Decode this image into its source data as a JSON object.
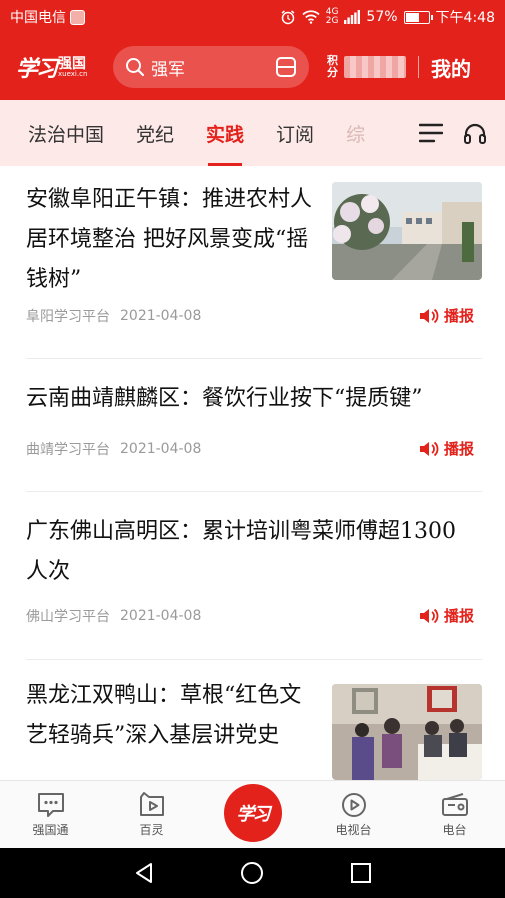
{
  "status_bar": {
    "carrier": "中国电信",
    "network": "4G",
    "network_sub": "2G",
    "battery_percent": "57%",
    "battery_level": 0.57,
    "time": "下午4:48"
  },
  "header": {
    "logo_cn": "学习",
    "logo_sub": "强国",
    "logo_en": "xuexi.cn",
    "search_text": "强军",
    "points_label_top": "积",
    "points_label_bottom": "分",
    "mine_label": "我的"
  },
  "tabs": [
    {
      "label": "法治中国",
      "active": false
    },
    {
      "label": "党纪",
      "active": false
    },
    {
      "label": "实践",
      "active": true
    },
    {
      "label": "订阅",
      "active": false
    },
    {
      "label": "综",
      "active": false
    }
  ],
  "articles": [
    {
      "title": "安徽阜阳正午镇：推进农村人居环境整治 把好风景变成“摇钱树”",
      "source": "阜阳学习平台",
      "date": "2021-04-08",
      "broadcast_label": "播报",
      "has_thumb": true
    },
    {
      "title": "云南曲靖麒麟区：餐饮行业按下“提质键”",
      "source": "曲靖学习平台",
      "date": "2021-04-08",
      "broadcast_label": "播报",
      "has_thumb": false
    },
    {
      "title": "广东佛山高明区：累计培训粤菜师傅超1300人次",
      "source": "佛山学习平台",
      "date": "2021-04-08",
      "broadcast_label": "播报",
      "has_thumb": false
    },
    {
      "title": "黑龙江双鸭山：草根“红色文艺轻骑兵”深入基层讲党史",
      "source": "",
      "date": "",
      "broadcast_label": "",
      "has_thumb": true
    }
  ],
  "bottom_nav": {
    "items": [
      {
        "label": "强国通",
        "icon": "chat-bubble-icon"
      },
      {
        "label": "百灵",
        "icon": "play-box-icon"
      },
      {
        "label": "",
        "icon": "xuexi-logo-icon",
        "center_text": "学习"
      },
      {
        "label": "电视台",
        "icon": "play-circle-icon"
      },
      {
        "label": "电台",
        "icon": "radio-icon"
      }
    ]
  },
  "colors": {
    "brand_red": "#e4221c",
    "tab_bg": "#fde9e7",
    "meta_gray": "#9a9a9a"
  }
}
